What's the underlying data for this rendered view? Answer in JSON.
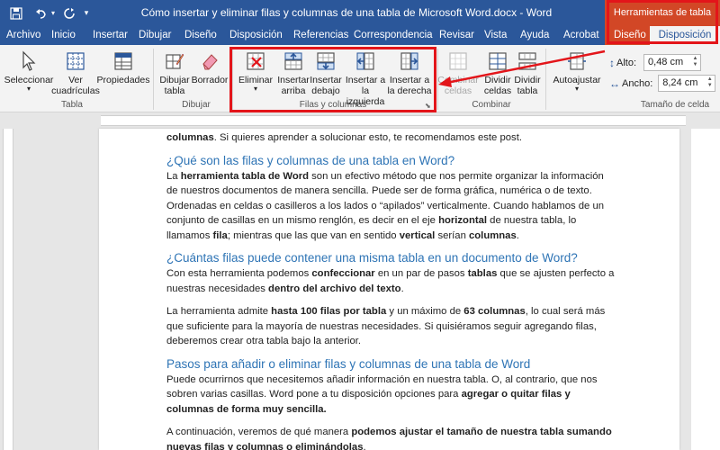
{
  "title_bar": {
    "save_icon": "save-icon",
    "undo_icon": "undo-icon",
    "redo_icon": "redo-icon",
    "customize_icon": "dropdown-icon",
    "document_title": "Cómo insertar y eliminar filas y columnas de una tabla de Microsoft Word.docx  -  Word",
    "context_label": "Herramientas de tabla"
  },
  "tabs": [
    "Archivo",
    "Inicio",
    "Insertar",
    "Dibujar",
    "Diseño",
    "Disposición",
    "Referencias",
    "Correspondencia",
    "Revisar",
    "Vista",
    "Ayuda",
    "Acrobat",
    "Diseño"
  ],
  "active_tab": "Disposición",
  "ribbon": {
    "tabla": {
      "seleccionar": "Seleccionar",
      "ver_cuadriculas": "Ver cuadrículas",
      "propiedades": "Propiedades",
      "group": "Tabla"
    },
    "dibujar": {
      "dibujar_tabla": "Dibujar tabla",
      "borrador": "Borrador",
      "group": "Dibujar"
    },
    "filas_columnas": {
      "eliminar": "Eliminar",
      "insertar_arriba": "Insertar arriba",
      "insertar_debajo": "Insertar debajo",
      "insertar_izquierda": "Insertar a la izquierda",
      "insertar_derecha": "Insertar a la derecha",
      "group": "Filas y columnas"
    },
    "combinar": {
      "combinar_celdas": "Combinar celdas",
      "dividir_celdas": "Dividir celdas",
      "dividir_tabla": "Dividir tabla",
      "group": "Combinar"
    },
    "tamano": {
      "autoajustar": "Autoajustar",
      "alto_label": "Alto:",
      "alto_value": "0,48 cm",
      "ancho_label": "Ancho:",
      "ancho_value": "8,24 cm",
      "group": "Tamaño de celda"
    }
  },
  "colors": {
    "word_blue": "#2b579a",
    "context_red": "#d24726",
    "highlight_red": "#e3151a",
    "heading_blue": "#2e74b5"
  },
  "document": {
    "p0": [
      "columnas",
      ". Si quieres aprender a solucionar esto, te recomendamos este post."
    ],
    "h1": "¿Qué son las filas y columnas de una tabla en Word?",
    "p1": [
      "La ",
      "herramienta tabla de Word",
      " son un efectivo método que nos permite organizar la información de nuestros documentos de manera sencilla. Puede ser de forma gráfica, numérica o de texto. Ordenadas en celdas o casilleros a los lados o “apilados” verticalmente. Cuando hablamos de un conjunto de casillas en un mismo renglón, es decir en el eje ",
      "horizontal",
      " de nuestra tabla, lo llamamos ",
      "fila",
      "; mientras que las que van en sentido ",
      "vertical",
      " serían ",
      "columnas",
      "."
    ],
    "h2": "¿Cuántas filas puede contener una misma tabla en un documento de Word?",
    "p2": [
      "Con esta herramienta podemos ",
      "confeccionar",
      " en un par de pasos ",
      "tablas",
      " que se ajusten perfecto a nuestras necesidades ",
      "dentro del archivo del texto",
      "."
    ],
    "p3": [
      "La herramienta admite ",
      "hasta 100 filas por tabla",
      " y un máximo de ",
      "63 columnas",
      ", lo cual será más que suficiente para la mayoría de nuestras necesidades. Si quisiéramos seguir agregando filas, deberemos crear otra tabla bajo la anterior."
    ],
    "h3": "Pasos para añadir o eliminar filas y columnas de una tabla de Word",
    "p4": [
      "Puede ocurrirnos que necesitemos añadir información en nuestra tabla. O, al contrario, que nos sobren varias casillas. Word pone a tu disposición opciones para ",
      "agregar o quitar filas y columnas de forma muy sencilla."
    ],
    "p5": [
      "A continuación, veremos de qué manera ",
      "podemos ajustar el tamaño de nuestra tabla sumando nuevas filas y columnas o eliminándolas",
      "."
    ]
  }
}
